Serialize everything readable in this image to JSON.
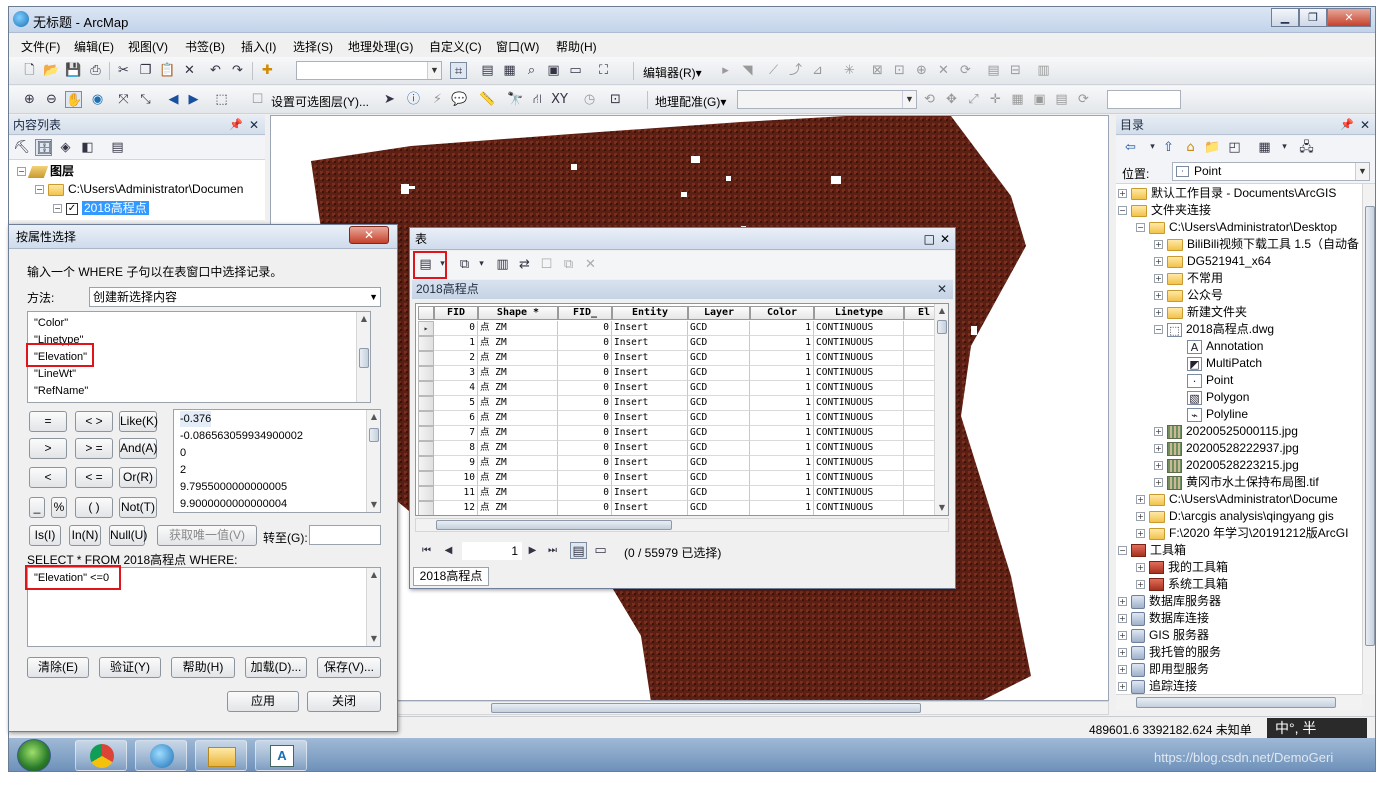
{
  "window": {
    "title": "无标题 - ArcMap",
    "min": "▁",
    "max": "❐",
    "close": "✕"
  },
  "menu": [
    "文件(F)",
    "编辑(E)",
    "视图(V)",
    "书签(B)",
    "插入(I)",
    "选择(S)",
    "地理处理(G)",
    "自定义(C)",
    "窗口(W)",
    "帮助(H)"
  ],
  "toolbar": {
    "editor_label": "编辑器(R)▾",
    "set_selectable_label": "设置可选图层(Y)...",
    "georef_label": "地理配准(G)▾"
  },
  "toc": {
    "title": "内容列表",
    "layers_label": "图层",
    "folder_path": "C:\\Users\\Administrator\\Documen",
    "layer_name": "2018高程点"
  },
  "catalog": {
    "title": "目录",
    "location_label": "位置:",
    "location_value": "Point",
    "items": [
      {
        "label": "默认工作目录 - Documents\\ArcGIS",
        "icon": "home"
      },
      {
        "label": "文件夹连接",
        "icon": "folder"
      },
      {
        "label": "C:\\Users\\Administrator\\Desktop",
        "icon": "folder"
      },
      {
        "label": "BiliBili视频下载工具 1.5（自动备",
        "icon": "folder"
      },
      {
        "label": "DG521941_x64",
        "icon": "folder"
      },
      {
        "label": "不常用",
        "icon": "folder"
      },
      {
        "label": "公众号",
        "icon": "folder"
      },
      {
        "label": "新建文件夹",
        "icon": "folder"
      },
      {
        "label": "2018高程点.dwg",
        "icon": "cad"
      },
      {
        "label": "Annotation",
        "icon": "A"
      },
      {
        "label": "MultiPatch",
        "icon": "mp"
      },
      {
        "label": "Point",
        "icon": "pt"
      },
      {
        "label": "Polygon",
        "icon": "pg"
      },
      {
        "label": "Polyline",
        "icon": "pl"
      },
      {
        "label": "20200525000115.jpg",
        "icon": "raster"
      },
      {
        "label": "20200528222937.jpg",
        "icon": "raster"
      },
      {
        "label": "20200528223215.jpg",
        "icon": "raster"
      },
      {
        "label": "黄冈市水土保持布局图.tif",
        "icon": "raster"
      },
      {
        "label": "C:\\Users\\Administrator\\Docume",
        "icon": "folder"
      },
      {
        "label": "D:\\arcgis analysis\\qingyang gis",
        "icon": "folder"
      },
      {
        "label": "F:\\2020 年学习\\20191212版ArcGI",
        "icon": "folder"
      },
      {
        "label": "工具箱",
        "icon": "toolbox"
      },
      {
        "label": "我的工具箱",
        "icon": "toolbox"
      },
      {
        "label": "系统工具箱",
        "icon": "toolbox"
      },
      {
        "label": "数据库服务器",
        "icon": "db"
      },
      {
        "label": "数据库连接",
        "icon": "db"
      },
      {
        "label": "GIS 服务器",
        "icon": "db"
      },
      {
        "label": "我托管的服务",
        "icon": "db"
      },
      {
        "label": "即用型服务",
        "icon": "db"
      },
      {
        "label": "追踪连接",
        "icon": "db"
      }
    ]
  },
  "dialog": {
    "title": "按属性选择",
    "close": "✕",
    "instruction": "输入一个 WHERE 子句以在表窗口中选择记录。",
    "method_label": "方法:",
    "method_value": "创建新选择内容",
    "fields": [
      "\"Color\"",
      "\"Linetype\"",
      "\"Elevation\"",
      "\"LineWt\"",
      "\"RefName\""
    ],
    "operators": [
      "=",
      "< >",
      "Like(K)",
      ">",
      "> =",
      "And(A)",
      "<",
      "< =",
      "Or(R)",
      "_",
      "%",
      "( )",
      "Not(T)"
    ],
    "values": [
      "-0.376",
      "-0.086563059934900002",
      "0",
      "2",
      "9.7955000000000005",
      "9.9000000000000004"
    ],
    "is_btn": "Is(I)",
    "in_btn": "In(N)",
    "null_btn": "Null(U)",
    "unique_btn": "获取唯一值(V)",
    "goto_label": "转至(G):",
    "sql_label": "SELECT * FROM 2018高程点 WHERE:",
    "sql_expression": "\"Elevation\" <=0",
    "clear_btn": "清除(E)",
    "verify_btn": "验证(Y)",
    "help_btn": "帮助(H)",
    "load_btn": "加载(D)...",
    "save_btn": "保存(V)...",
    "apply_btn": "应用",
    "close_btn": "关闭"
  },
  "table": {
    "title": "表",
    "tab_title": "2018高程点",
    "columns": [
      "FID",
      "Shape *",
      "FID_",
      "Entity",
      "Layer",
      "Color",
      "Linetype",
      "El"
    ],
    "rows": [
      [
        "0",
        "点 ZM",
        "0",
        "Insert",
        "GCD",
        "1",
        "CONTINUOUS"
      ],
      [
        "1",
        "点 ZM",
        "0",
        "Insert",
        "GCD",
        "1",
        "CONTINUOUS"
      ],
      [
        "2",
        "点 ZM",
        "0",
        "Insert",
        "GCD",
        "1",
        "CONTINUOUS"
      ],
      [
        "3",
        "点 ZM",
        "0",
        "Insert",
        "GCD",
        "1",
        "CONTINUOUS"
      ],
      [
        "4",
        "点 ZM",
        "0",
        "Insert",
        "GCD",
        "1",
        "CONTINUOUS"
      ],
      [
        "5",
        "点 ZM",
        "0",
        "Insert",
        "GCD",
        "1",
        "CONTINUOUS"
      ],
      [
        "6",
        "点 ZM",
        "0",
        "Insert",
        "GCD",
        "1",
        "CONTINUOUS"
      ],
      [
        "7",
        "点 ZM",
        "0",
        "Insert",
        "GCD",
        "1",
        "CONTINUOUS"
      ],
      [
        "8",
        "点 ZM",
        "0",
        "Insert",
        "GCD",
        "1",
        "CONTINUOUS"
      ],
      [
        "9",
        "点 ZM",
        "0",
        "Insert",
        "GCD",
        "1",
        "CONTINUOUS"
      ],
      [
        "10",
        "点 ZM",
        "0",
        "Insert",
        "GCD",
        "1",
        "CONTINUOUS"
      ],
      [
        "11",
        "点 ZM",
        "0",
        "Insert",
        "GCD",
        "1",
        "CONTINUOUS"
      ],
      [
        "12",
        "点 ZM",
        "0",
        "Insert",
        "GCD",
        "1",
        "CONTINUOUS"
      ]
    ],
    "record_number": "1",
    "selection_status": "(0 / 55979 已选择)",
    "bottom_tab": "2018高程点"
  },
  "status": {
    "coords": "489601.6  3392182.624 未知单",
    "ime": "中°, 半"
  },
  "watermark": "https://blog.csdn.net/DemoGeri",
  "colors": {
    "map_fill": "#5b1f14",
    "highlight_red": "#e0141b",
    "selection_blue": "#3399ff"
  }
}
